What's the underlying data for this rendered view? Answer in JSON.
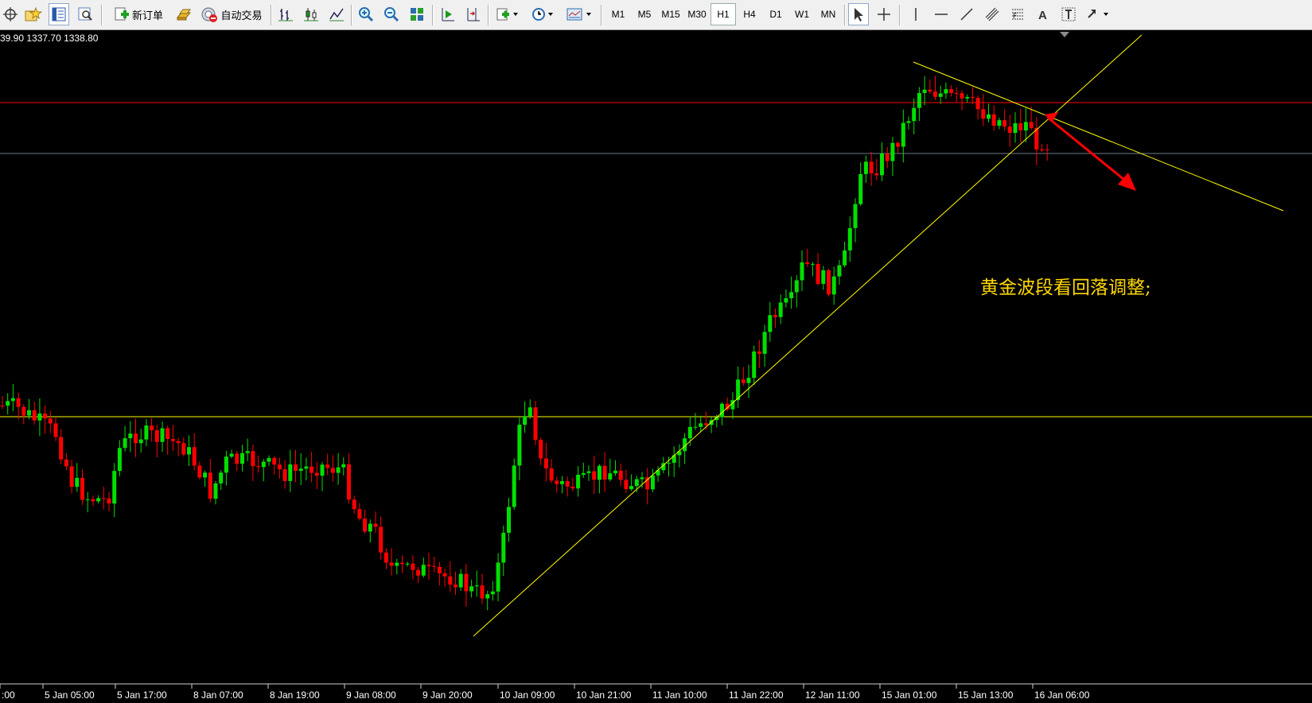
{
  "toolbar": {
    "new_order_label": "新订单",
    "auto_trade_label": "自动交易",
    "timeframes": [
      "M1",
      "M5",
      "M15",
      "M30",
      "H1",
      "H4",
      "D1",
      "W1",
      "MN"
    ],
    "active_timeframe": "H1",
    "icons": [
      "crosshair-move-icon",
      "favorites-icon",
      "navigator-icon",
      "zoom-window-icon",
      "new-order-icon",
      "gold-bars-icon",
      "auto-trading-icon",
      "bar-chart-icon",
      "candlestick-chart-icon",
      "line-chart-icon",
      "zoom-in-icon",
      "zoom-out-icon",
      "tile-windows-icon",
      "auto-scroll-icon",
      "chart-shift-icon",
      "indicators-icon",
      "periods-clock-icon",
      "templates-icon",
      "cursor-icon",
      "crosshair-icon",
      "vertical-line-icon",
      "horizontal-line-icon",
      "trendline-icon",
      "equidistant-channel-icon",
      "fibonacci-icon",
      "text-icon",
      "text-label-icon",
      "arrows-icon"
    ]
  },
  "chart": {
    "price_info": "39.90 1337.70 1338.80",
    "annotation": "黄金波段看回落调整;",
    "time_labels": [
      ":00",
      "5 Jan 05:00",
      "5 Jan 17:00",
      "8 Jan 07:00",
      "8 Jan 19:00",
      "9 Jan 08:00",
      "9 Jan 20:00",
      "10 Jan 09:00",
      "10 Jan 21:00",
      "11 Jan 10:00",
      "11 Jan 22:00",
      "12 Jan 11:00",
      "15 Jan 01:00",
      "15 Jan 13:00",
      "16 Jan 06:00"
    ],
    "colors": {
      "background": "#000000",
      "bull": "#00e000",
      "bear": "#ff0000",
      "wick_bull": "#00e000",
      "wick_bear": "#ff0000",
      "trendline": "#ffff00",
      "support_line": "#ffff00",
      "resistance_line": "#ff0000",
      "bid_line": "#6d7b8a",
      "arrow": "#ff0000",
      "text": "#ffffff"
    }
  }
}
